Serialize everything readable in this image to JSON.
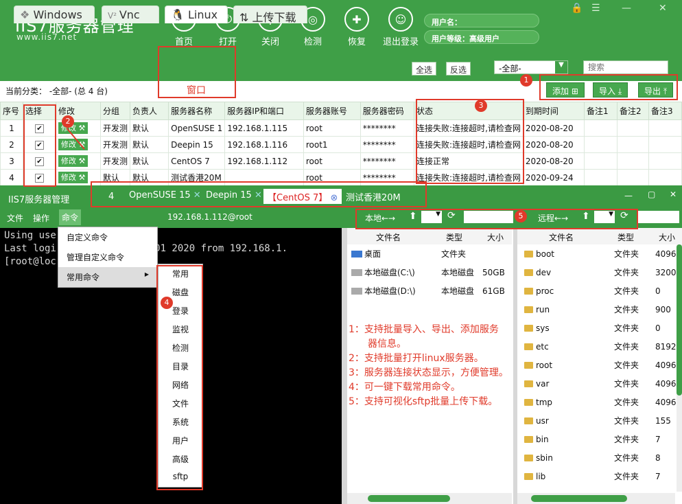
{
  "app": {
    "logo": "IIS7服务器管理",
    "url": "www.iis7.net"
  },
  "nav": [
    {
      "label": "首页",
      "icon": "home-icon"
    },
    {
      "label": "打开",
      "icon": "power-icon"
    },
    {
      "label": "关闭",
      "icon": "close-plug-icon"
    },
    {
      "label": "检测",
      "icon": "radar-icon"
    },
    {
      "label": "恢复",
      "icon": "tools-icon"
    },
    {
      "label": "退出登录",
      "icon": "user-icon"
    }
  ],
  "user": {
    "name_label": "用户名：",
    "level_label": "用户等级：高级用户"
  },
  "os_tabs": [
    {
      "label": "Windows"
    },
    {
      "label": "Vnc"
    },
    {
      "label": "Linux"
    },
    {
      "label": "上传下载"
    }
  ],
  "toolbar": {
    "select_all": "全选",
    "invert": "反选",
    "filter": "-全部-",
    "search_placeholder": "搜索",
    "add": "添加",
    "import": "导入",
    "export": "导出"
  },
  "category": "当前分类： -全部- (总 4 台)",
  "callout_window": "窗口",
  "columns": [
    "序号",
    "选择",
    "修改",
    "分组",
    "负责人",
    "服务器名称",
    "服务器IP和端口",
    "服务器账号",
    "服务器密码",
    "状态",
    "到期时间",
    "备注1",
    "备注2",
    "备注3"
  ],
  "rows": [
    {
      "no": "1",
      "edit": "修改",
      "group": "开发测",
      "owner": "默认",
      "name": "OpenSUSE 1",
      "ip": "192.168.1.115",
      "acct": "root",
      "pwd": "********",
      "status": "连接失败:连接超时,请检查网",
      "exp": "2020-08-20"
    },
    {
      "no": "2",
      "edit": "修改",
      "group": "开发测",
      "owner": "默认",
      "name": "Deepin 15",
      "ip": "192.168.1.116",
      "acct": "root1",
      "pwd": "********",
      "status": "连接失败:连接超时,请检查网",
      "exp": "2020-08-20"
    },
    {
      "no": "3",
      "edit": "修改",
      "group": "开发测",
      "owner": "默认",
      "name": "CentOS 7",
      "ip": "192.168.1.112",
      "acct": "root",
      "pwd": "********",
      "status": "连接正常",
      "exp": "2020-08-20"
    },
    {
      "no": "4",
      "edit": "修改",
      "group": "默认",
      "owner": "默认",
      "name": "测试香港20M",
      "ip": "",
      "acct": "root",
      "pwd": "********",
      "status": "连接失败:连接超时,请检查网",
      "exp": "2020-09-24"
    }
  ],
  "win2": {
    "title": "IIS7服务器管理",
    "count": "4",
    "tabs": [
      "OpenSUSE 15",
      "Deepin 15",
      "【CentOS 7】",
      "测试香港20M"
    ],
    "menu": [
      "文件",
      "操作",
      "命令"
    ],
    "host": "192.168.1.112@root",
    "local": "本地←→",
    "remote": "远程←→"
  },
  "terminal": [
    "Using use",
    "Last logi             :37:01 2020 from 192.168.1.",
    "[root@loc"
  ],
  "cmd_menu": [
    "自定义命令",
    "管理自定义命令",
    "常用命令"
  ],
  "sub_menu": [
    "常用",
    "磁盘",
    "登录",
    "监视",
    "检测",
    "目录",
    "网络",
    "文件",
    "系统",
    "用户",
    "高级",
    "sftp"
  ],
  "local_head": [
    "文件名",
    "类型",
    "大小"
  ],
  "local_files": [
    [
      "桌面",
      "文件夹",
      ""
    ],
    [
      "本地磁盘(C:\\)",
      "本地磁盘",
      "50GB"
    ],
    [
      "本地磁盘(D:\\)",
      "本地磁盘",
      "61GB"
    ]
  ],
  "notes": [
    "1：支持批量导入、导出、添加服务",
    "　　器信息。",
    "2：支持批量打开linux服务器。",
    "3：服务器连接状态显示，方便管理。",
    "4：可一键下载常用命令。",
    "5：支持可视化sftp批量上传下载。"
  ],
  "remote_head": [
    "文件名",
    "类型",
    "大小"
  ],
  "remote_files": [
    [
      "boot",
      "文件夹",
      "4096"
    ],
    [
      "dev",
      "文件夹",
      "3200"
    ],
    [
      "proc",
      "文件夹",
      "0"
    ],
    [
      "run",
      "文件夹",
      "900"
    ],
    [
      "sys",
      "文件夹",
      "0"
    ],
    [
      "etc",
      "文件夹",
      "8192"
    ],
    [
      "root",
      "文件夹",
      "4096"
    ],
    [
      "var",
      "文件夹",
      "4096"
    ],
    [
      "tmp",
      "文件夹",
      "4096"
    ],
    [
      "usr",
      "文件夹",
      "155"
    ],
    [
      "bin",
      "文件夹",
      "7"
    ],
    [
      "sbin",
      "文件夹",
      "8"
    ],
    [
      "lib",
      "文件夹",
      "7"
    ]
  ],
  "badges": [
    "1",
    "2",
    "3",
    "4",
    "5"
  ]
}
